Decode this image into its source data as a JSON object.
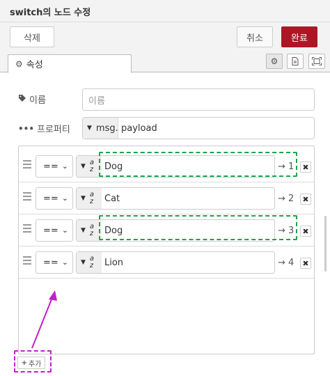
{
  "header": {
    "title": "switch의 노드 수정"
  },
  "toolbar": {
    "delete_label": "삭제",
    "cancel_label": "취소",
    "done_label": "완료"
  },
  "tabs": {
    "properties_label": "속성"
  },
  "form": {
    "name_label": "이름",
    "name_placeholder": "이름",
    "property_label": "프로퍼티",
    "property_type": "msg.",
    "property_value": "payload"
  },
  "rules": [
    {
      "operator": "==",
      "value": "Dog",
      "output": "→ 1"
    },
    {
      "operator": "==",
      "value": "Cat",
      "output": "→ 2"
    },
    {
      "operator": "==",
      "value": "Dog",
      "output": "→ 3"
    },
    {
      "operator": "==",
      "value": "Lion",
      "output": "→ 4"
    }
  ],
  "add_label": "추가",
  "colors": {
    "done_button": "#ad1625",
    "highlight_green": "#1aa34a",
    "highlight_magenta": "#c020c8"
  }
}
